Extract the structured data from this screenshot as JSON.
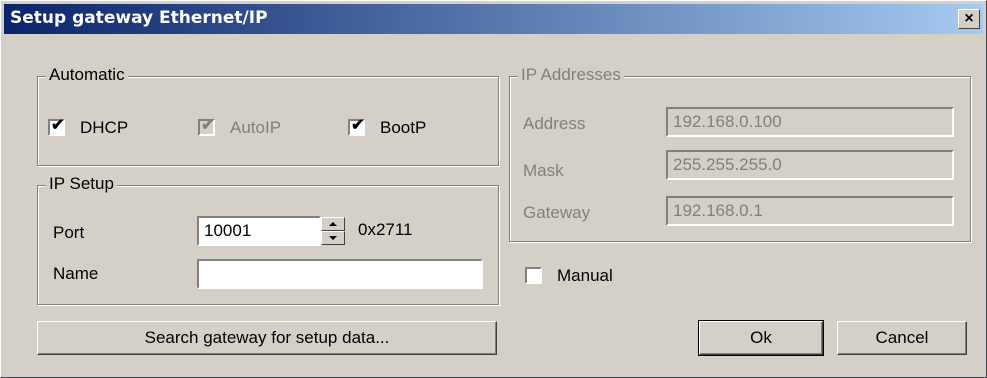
{
  "window": {
    "title": "Setup gateway Ethernet/IP",
    "close_label": "×"
  },
  "automatic": {
    "legend": "Automatic",
    "dhcp": {
      "label": "DHCP",
      "checked": true
    },
    "autoip": {
      "label": "AutoIP",
      "checked": true,
      "enabled": false
    },
    "bootp": {
      "label": "BootP",
      "checked": true
    }
  },
  "ip_setup": {
    "legend": "IP Setup",
    "port_label": "Port",
    "port_value": "10001",
    "port_hex": "0x2711",
    "name_label": "Name",
    "name_value": ""
  },
  "ip_addresses": {
    "legend": "IP Addresses",
    "address_label": "Address",
    "address_value": "192.168.0.100",
    "mask_label": "Mask",
    "mask_value": "255.255.255.0",
    "gateway_label": "Gateway",
    "gateway_value": "192.168.0.1"
  },
  "manual": {
    "label": "Manual",
    "checked": false
  },
  "buttons": {
    "search": "Search gateway for setup data...",
    "ok": "Ok",
    "cancel": "Cancel"
  },
  "marks": {
    "check": "✔"
  }
}
